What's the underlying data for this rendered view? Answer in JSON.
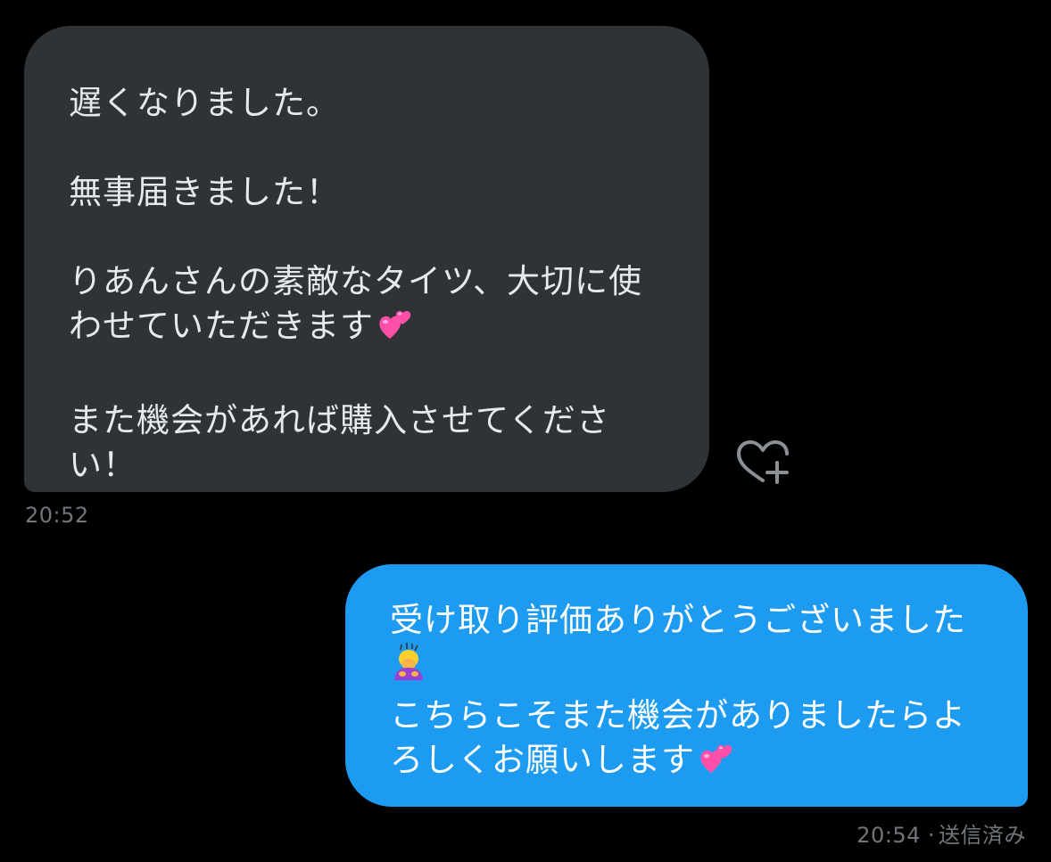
{
  "conversation": {
    "incoming_message": {
      "paragraphs": [
        {
          "lines": [
            "遅くなりました。"
          ]
        },
        {
          "lines": [
            "無事届きました！"
          ]
        },
        {
          "lines": [
            "りあんさんの素敵なタイツ、大切に使",
            "わせていただきます"
          ],
          "trailing_emoji": "two-hearts-emoji"
        },
        {
          "lines": [
            "また機会があれば購入させてくださ",
            "い！"
          ]
        }
      ],
      "timestamp": "20:52"
    },
    "react_icon": "heart-plus-icon",
    "outgoing_message": {
      "line1": "受け取り評価ありがとうございました",
      "line2_emoji": "person-bowing-emoji",
      "line3": "こちらこそまた機会がありましたらよ",
      "line4": "ろしくお願いします",
      "line4_emoji": "two-hearts-emoji",
      "timestamp": "20:54",
      "separator": "·",
      "status": "送信済み"
    }
  },
  "colors": {
    "background": "#000000",
    "incoming_bubble": "#2f3336",
    "outgoing_bubble": "#1d9bf0",
    "timestamp": "#71767b",
    "heart_emoji": "#ff4fa8"
  }
}
